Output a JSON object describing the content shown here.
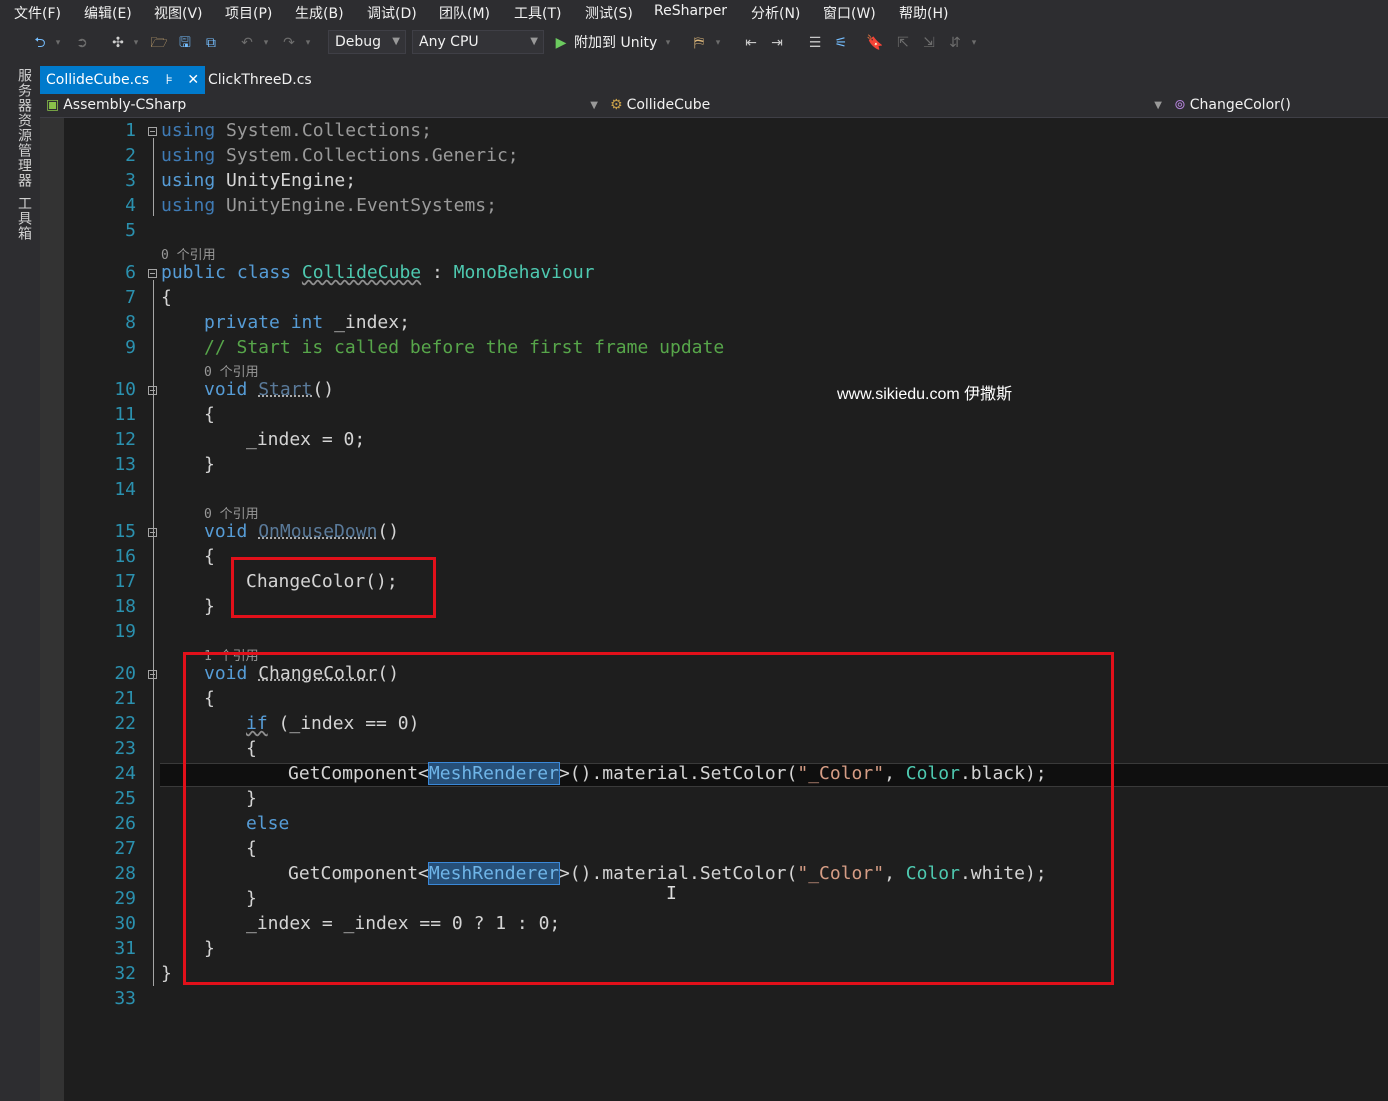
{
  "menu": [
    "文件(F)",
    "编辑(E)",
    "视图(V)",
    "项目(P)",
    "生成(B)",
    "调试(D)",
    "团队(M)",
    "工具(T)",
    "测试(S)",
    "ReSharper",
    "分析(N)",
    "窗口(W)",
    "帮助(H)"
  ],
  "toolbar": {
    "configuration": "Debug",
    "platform": "Any CPU",
    "attach_label": "附加到 Unity"
  },
  "side_panels": [
    "服务器资源管理器",
    "工具箱"
  ],
  "tabs": [
    {
      "label": "CollideCube.cs",
      "active": true
    },
    {
      "label": "ClickThreeD.cs",
      "active": false
    }
  ],
  "navbar": {
    "project": "Assembly-CSharp",
    "class": "CollideCube",
    "member": "ChangeColor()"
  },
  "code": {
    "line_numbers": [
      "1",
      "2",
      "3",
      "4",
      "5",
      "6",
      "7",
      "8",
      "9",
      "10",
      "11",
      "12",
      "13",
      "14",
      "15",
      "16",
      "17",
      "18",
      "19",
      "20",
      "21",
      "22",
      "23",
      "24",
      "25",
      "26",
      "27",
      "28",
      "29",
      "30",
      "31",
      "32",
      "33"
    ],
    "ref_zero": "0 个引用",
    "ref_one": "1 个引用",
    "l1_kw": "using",
    "l1_ns": "System.Collections;",
    "l2_kw": "using",
    "l2_ns": "System.Collections.Generic;",
    "l3_kw": "using",
    "l3_ns": "UnityEngine;",
    "l4_kw": "using",
    "l4_ns": "UnityEngine.EventSystems;",
    "l6_public": "public",
    "l6_class": "class",
    "l6_name": "CollideCube",
    "l6_colon": " : ",
    "l6_base": "MonoBehaviour",
    "open_brace": "{",
    "close_brace": "}",
    "l8_private": "private",
    "l8_int": "int",
    "l8_rest": "_index;",
    "l9_comment": "// Start is called before the first frame update",
    "void": "void",
    "l10_name": "Start",
    "parens": "()",
    "l12": "_index = 0;",
    "l15_name": "OnMouseDown",
    "l17": "ChangeColor();",
    "l20_name": "ChangeColor",
    "l22_if": "if",
    "l22_rest": " (_index == 0)",
    "getcomponent": "GetComponent<",
    "meshrenderer": "MeshRenderer",
    "material_setcolor": ">().material.SetColor(",
    "color_str": "\"_Color\"",
    "comma": ", ",
    "color_type": "Color",
    "black_tail": ".black);",
    "white_tail": ".white);",
    "l26_else": "else",
    "l30": "_index = _index == 0 ? 1 : 0;"
  },
  "watermark": "www.sikiedu.com 伊撒斯"
}
